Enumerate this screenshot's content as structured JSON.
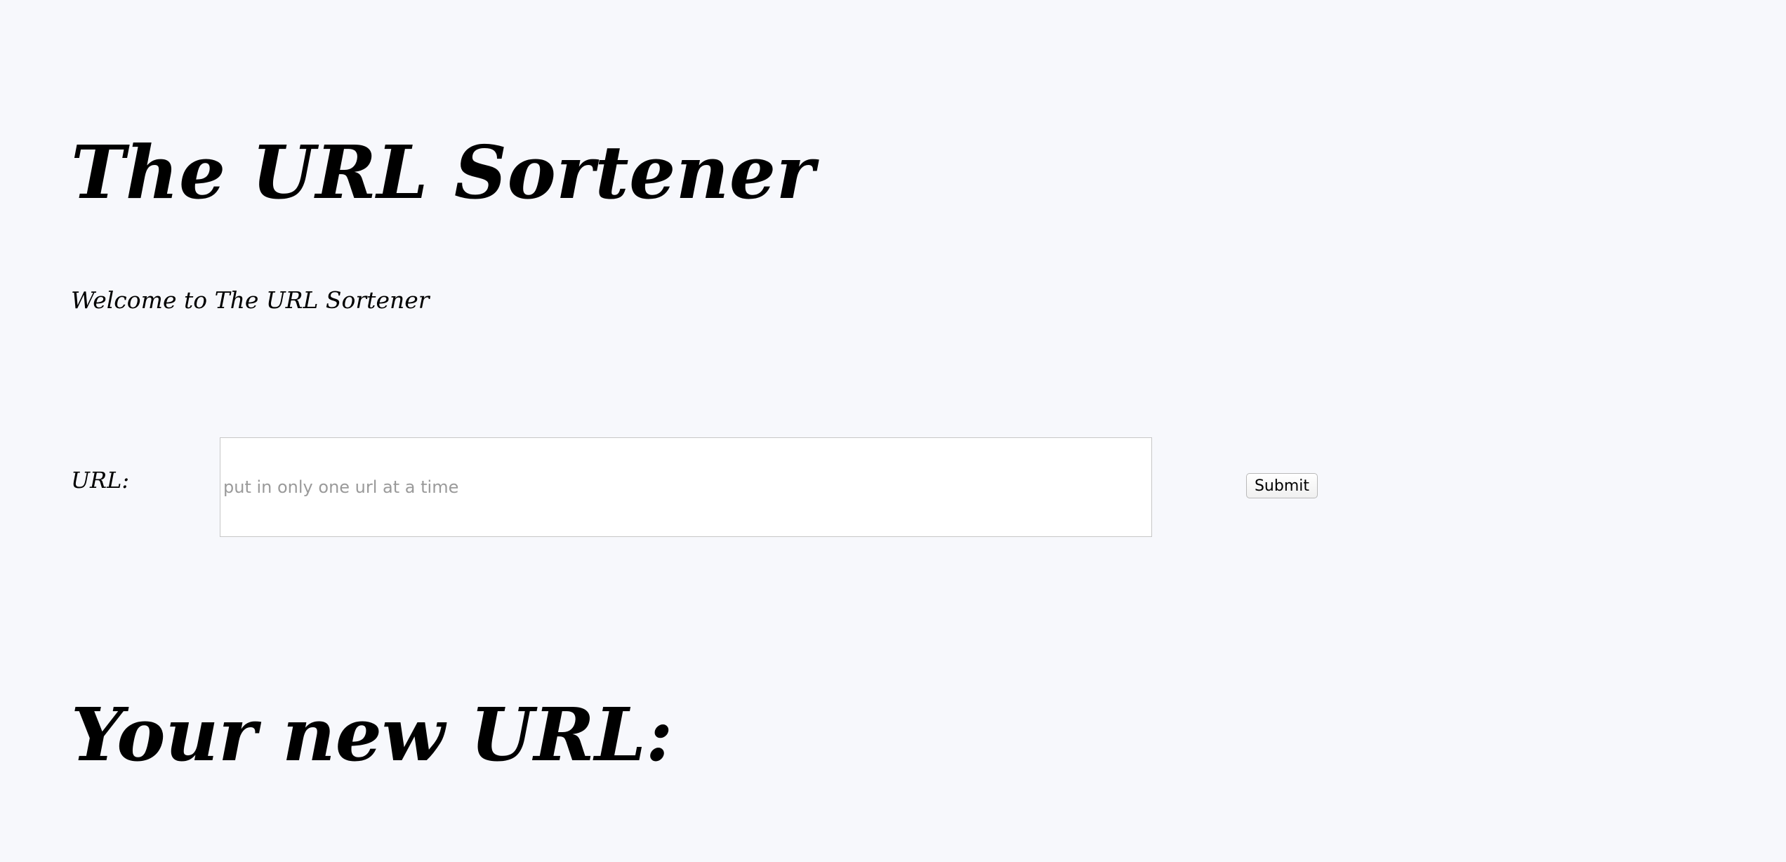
{
  "header": {
    "title": "The URL Sortener",
    "welcome": "Welcome to The URL Sortener"
  },
  "form": {
    "url_label": "URL:",
    "url_placeholder": "put in only one url at a time",
    "url_value": "",
    "submit_label": "Submit"
  },
  "result": {
    "heading": "Your new URL:"
  },
  "colors": {
    "background": "#f7f8fc",
    "text": "#000000",
    "placeholder": "#9a9a9a",
    "input_border": "#c7c7c7"
  }
}
